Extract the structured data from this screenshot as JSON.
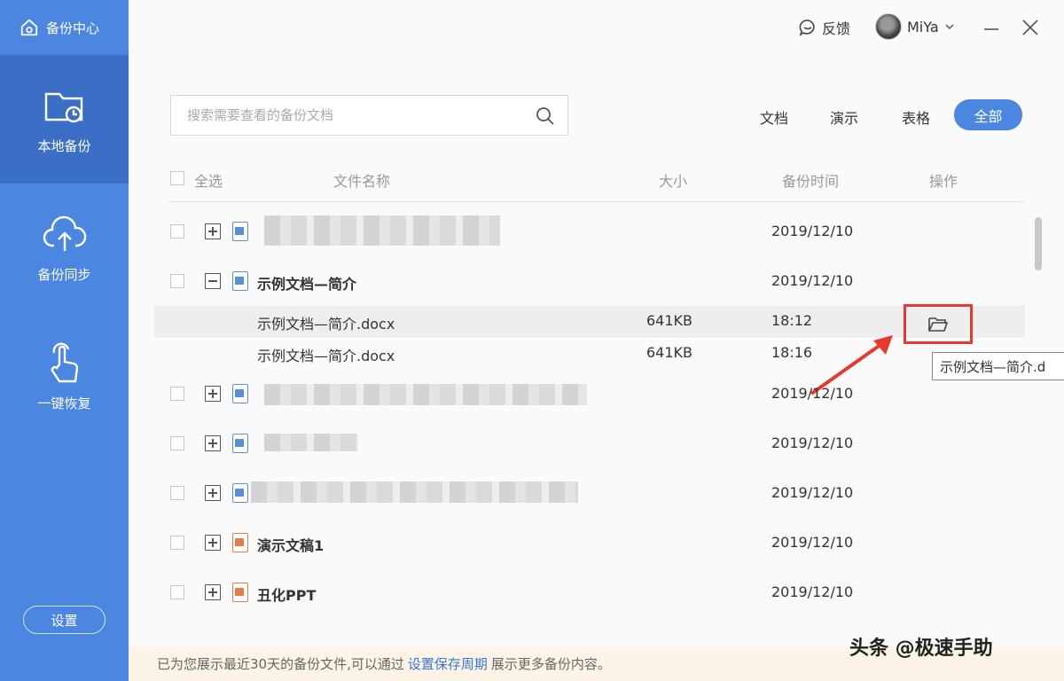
{
  "app": {
    "title": "备份中心"
  },
  "sidebar": {
    "items": [
      {
        "label": "本地备份",
        "icon": "folder-clock-icon",
        "active": true
      },
      {
        "label": "备份同步",
        "icon": "cloud-upload-icon",
        "active": false
      },
      {
        "label": "一键恢复",
        "icon": "hand-pointer-icon",
        "active": false
      }
    ],
    "settings_label": "设置"
  },
  "header": {
    "feedback_label": "反馈",
    "username": "MiYa"
  },
  "search": {
    "placeholder": "搜索需要查看的备份文档"
  },
  "filters": [
    {
      "label": "文档",
      "active": false
    },
    {
      "label": "演示",
      "active": false
    },
    {
      "label": "表格",
      "active": false
    },
    {
      "label": "全部",
      "active": true
    }
  ],
  "table": {
    "headers": {
      "select_all": "全选",
      "name": "文件名称",
      "size": "大小",
      "time": "备份时间",
      "action": "操作"
    },
    "rows": [
      {
        "name": "",
        "date": "2019/12/10",
        "type": "doc",
        "expanded": false
      },
      {
        "name": "示例文档—简介",
        "date": "2019/12/10",
        "type": "doc",
        "expanded": true,
        "children": [
          {
            "name": "示例文档—简介.docx",
            "size": "641KB",
            "time": "18:12"
          },
          {
            "name": "示例文档—简介.docx",
            "size": "641KB",
            "time": "18:16"
          }
        ]
      },
      {
        "name": "",
        "date": "2019/12/10",
        "type": "doc",
        "expanded": false
      },
      {
        "name": "",
        "date": "2019/12/10",
        "type": "doc",
        "expanded": false
      },
      {
        "name": "",
        "date": "2019/12/10",
        "type": "doc",
        "expanded": false
      },
      {
        "name": "演示文稿1",
        "date": "2019/12/10",
        "type": "ppt",
        "expanded": false
      },
      {
        "name": "丑化PPT",
        "date": "2019/12/10",
        "type": "ppt",
        "expanded": false
      }
    ]
  },
  "tooltip": {
    "text": "示例文档—简介.d"
  },
  "footer": {
    "prefix": "已为您展示最近30天的备份文件,可以通过",
    "link": "设置保存周期",
    "suffix": "展示更多备份内容。"
  },
  "watermark": "头条 @极速手助",
  "colors": {
    "accent": "#4b86e0",
    "sidebar_active": "#3b6fc6",
    "highlight": "#e63a2e",
    "footer_bg": "#fdf3e6"
  }
}
